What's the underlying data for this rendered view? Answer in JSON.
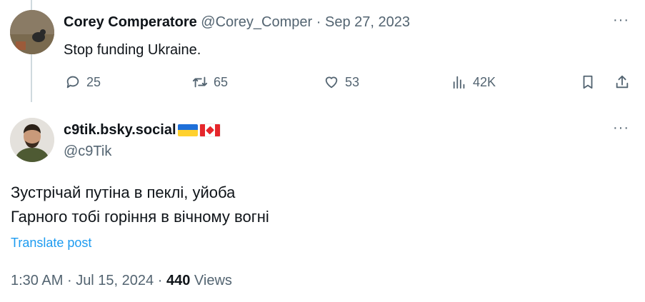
{
  "parent_tweet": {
    "display_name": "Corey Comperatore",
    "handle": "@Corey_Comper",
    "separator": "·",
    "date": "Sep 27, 2023",
    "text": "Stop funding Ukraine.",
    "more": "···",
    "actions": {
      "reply_count": "25",
      "retweet_count": "65",
      "like_count": "53",
      "views_count": "42K"
    }
  },
  "reply_tweet": {
    "display_name": "c9tik.bsky.social",
    "flags": [
      "ukraine-flag",
      "canada-flag"
    ],
    "handle": "@c9Tik",
    "more": "···",
    "text_lines": [
      "Зустрічай путіна в пеклі, уйоба",
      "Гарного тобі горіння в вічному вогні"
    ],
    "translate_label": "Translate post",
    "time": "1:30 AM",
    "separator": "·",
    "date": "Jul 15, 2024",
    "separator2": "·",
    "views_count": "440",
    "views_label": "Views"
  },
  "colors": {
    "text": "#0f1419",
    "secondary": "#536471",
    "link": "#1d9bf0",
    "thread_line": "#cfd9de"
  }
}
